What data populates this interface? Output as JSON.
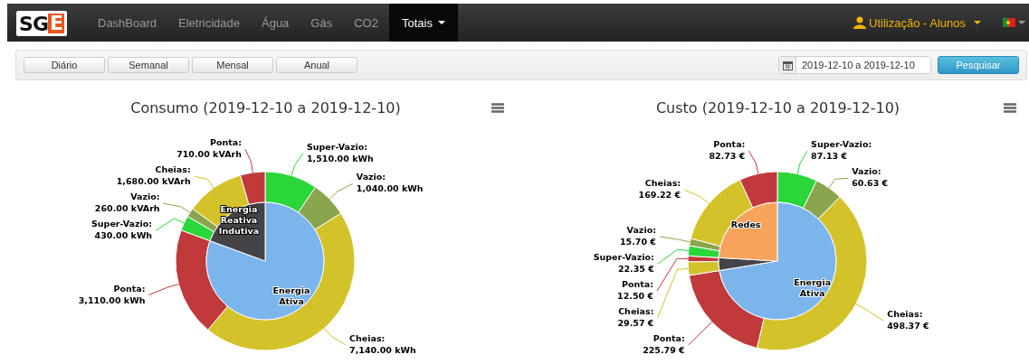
{
  "navbar": {
    "logo": {
      "text_1": "SG",
      "text_2": "E"
    },
    "items": [
      {
        "label": "DashBoard",
        "selected": false
      },
      {
        "label": "Eletricidade",
        "selected": false
      },
      {
        "label": "Água",
        "selected": false
      },
      {
        "label": "Gás",
        "selected": false
      },
      {
        "label": "CO2",
        "selected": false
      },
      {
        "label": "Totais",
        "selected": true,
        "dropdown": true
      }
    ],
    "user_menu": {
      "label": "Utilização - Alunos"
    }
  },
  "toolbar": {
    "period_buttons": [
      "Diário",
      "Semanal",
      "Mensal",
      "Anual"
    ],
    "date_range": {
      "value": "2019-12-10 a 2019-12-10"
    },
    "search_button": "Pesquisar"
  },
  "charts": [
    {
      "chart_data": {
        "type": "donut",
        "title": "Consumo (2019-12-10 a 2019-12-10)",
        "series": [
          {
            "value_labels": [
              "Energia Ativa",
              "Energia Reativa Indutiva"
            ],
            "colors": [
              "#7cb5ec",
              "#434348"
            ],
            "values": [
              80.6,
              19.4
            ]
          },
          {
            "value_labels": [
              "Super-Vazio:\n1,510.00 kWh",
              "Vazio:\n1,040.00 kWh",
              "Cheias:\n7,140.00 kWh",
              "Ponta:\n3,110.00 kWh",
              "Super-Vazio:\n430.00 kWh",
              "Vazio:\n260.00 kVArh",
              "Cheias:\n1,680.00 kVArh",
              "Ponta:\n710.00 kVArh"
            ],
            "colors": [
              "#2bd63a",
              "#8aa54d",
              "#d4c22b",
              "#c0393b",
              "#2bd63a",
              "#8aa54d",
              "#d4c22b",
              "#c0393b"
            ],
            "values": [
              1510,
              1040,
              7140,
              3110,
              430,
              260,
              1680,
              710
            ]
          }
        ]
      }
    },
    {
      "chart_data": {
        "type": "donut",
        "title": "Custo (2019-12-10 a 2019-12-10)",
        "series": [
          {
            "value_labels": [
              "Energia Ativa",
              null,
              "Redes"
            ],
            "colors": [
              "#7cb5ec",
              "#434348",
              "#f7a35c"
            ],
            "values": [
              72.42,
              3.49,
              24.09
            ]
          },
          {
            "value_labels": [
              "Super-Vazio:\n87.13 €",
              "Vazio:\n60.63 €",
              "Cheias:\n498.37 €",
              "Ponta:\n225.79 €",
              "Cheias:\n29.57 €",
              "Ponta:\n12.50 €",
              "Super-Vazio:\n22.35 €",
              "Vazio:\n15.70 €",
              "Cheias:\n169.22 €",
              "Ponta:\n82.73 €"
            ],
            "colors": [
              "#2bd63a",
              "#8aa54d",
              "#d4c22b",
              "#c0393b",
              "#d4c22b",
              "#c0393b",
              "#2bd63a",
              "#8aa54d",
              "#d4c22b",
              "#c0393b"
            ],
            "values": [
              87.13,
              60.63,
              498.37,
              225.79,
              29.57,
              12.5,
              22.35,
              15.7,
              169.22,
              82.73
            ]
          }
        ]
      }
    }
  ]
}
